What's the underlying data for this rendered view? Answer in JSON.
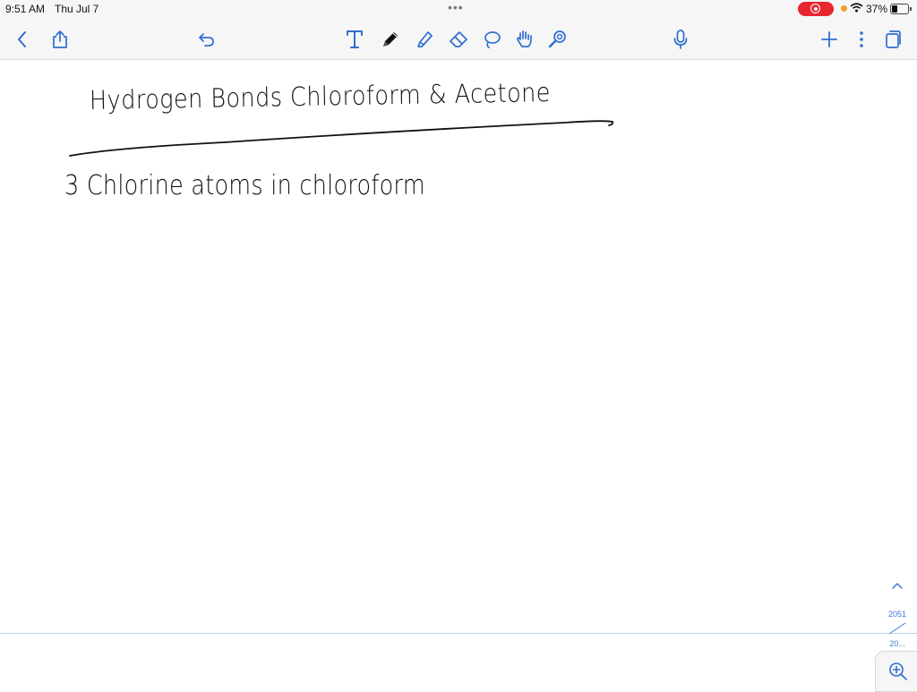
{
  "status_bar": {
    "time": "9:51 AM",
    "date": "Thu Jul 7",
    "battery_percent": "37%",
    "battery_level": 0.37,
    "recording": true
  },
  "toolbar": {
    "accent_color": "#2f6fd0",
    "left_tools": [
      {
        "name": "back",
        "icon": "chevron-left-icon"
      },
      {
        "name": "share",
        "icon": "share-icon"
      },
      {
        "name": "undo",
        "icon": "undo-icon"
      }
    ],
    "center_tools": [
      {
        "name": "text",
        "icon": "text-tool-icon"
      },
      {
        "name": "pen",
        "icon": "pen-icon",
        "selected": true
      },
      {
        "name": "highlighter",
        "icon": "highlighter-icon"
      },
      {
        "name": "eraser",
        "icon": "eraser-icon"
      },
      {
        "name": "lasso",
        "icon": "lasso-icon"
      },
      {
        "name": "hand",
        "icon": "hand-icon"
      },
      {
        "name": "laser",
        "icon": "laser-pointer-icon"
      }
    ],
    "right_tools": [
      {
        "name": "microphone",
        "icon": "microphone-icon"
      },
      {
        "name": "add",
        "icon": "plus-icon"
      },
      {
        "name": "more",
        "icon": "more-vertical-icon"
      },
      {
        "name": "pages",
        "icon": "pages-icon"
      }
    ]
  },
  "note": {
    "handwritten_lines": [
      "Hydrogen Bonds Chloroform & Acetone",
      "3 Chlorine atoms in chloroform"
    ],
    "ink_color": "#111111"
  },
  "pager": {
    "current_page": "2051",
    "total_pages": "20..."
  },
  "zoom": {
    "icon": "zoom-in-icon"
  }
}
